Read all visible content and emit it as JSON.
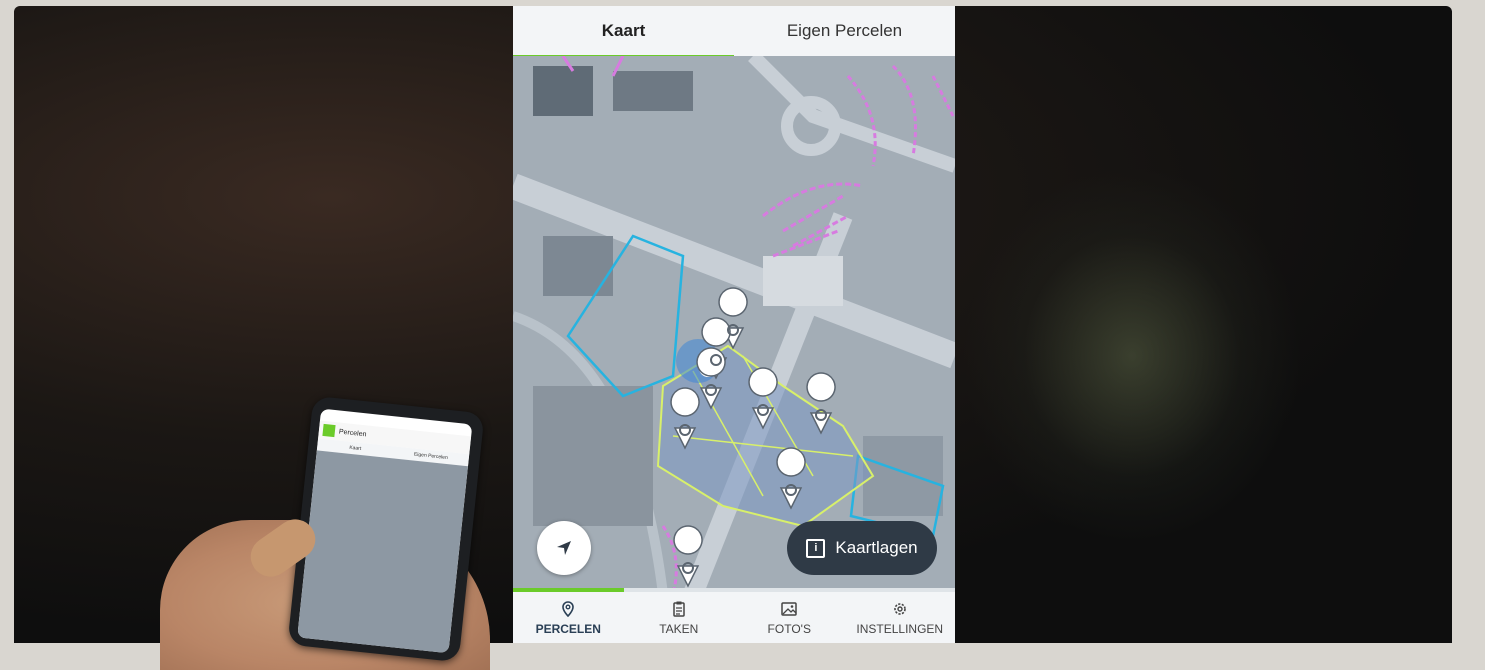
{
  "app": {
    "tabs": [
      {
        "label": "Kaart",
        "active": true
      },
      {
        "label": "Eigen Percelen",
        "active": false
      }
    ],
    "map": {
      "layers_button_label": "Kaartlagen",
      "locate_icon": "navigation-arrow-icon",
      "layers_icon": "info-square-icon"
    },
    "progress": 0.25,
    "bottom_nav": [
      {
        "label": "PERCELEN",
        "icon": "map-pin-icon",
        "active": true
      },
      {
        "label": "TAKEN",
        "icon": "clipboard-icon",
        "active": false
      },
      {
        "label": "FOTO'S",
        "icon": "image-icon",
        "active": false
      },
      {
        "label": "INSTELLINGEN",
        "icon": "gear-icon",
        "active": false
      }
    ]
  },
  "handheld_phone": {
    "title": "Percelen",
    "tabs": [
      "Kaart",
      "Eigen Percelen"
    ]
  },
  "colors": {
    "accent": "#6bcb2a",
    "nav_background": "#f3f5f7",
    "button_dark": "#2f3a46",
    "parcel_outline": "#d8f06a",
    "water_outline": "#27b3e0",
    "zone_hatch": "#d77be0"
  }
}
